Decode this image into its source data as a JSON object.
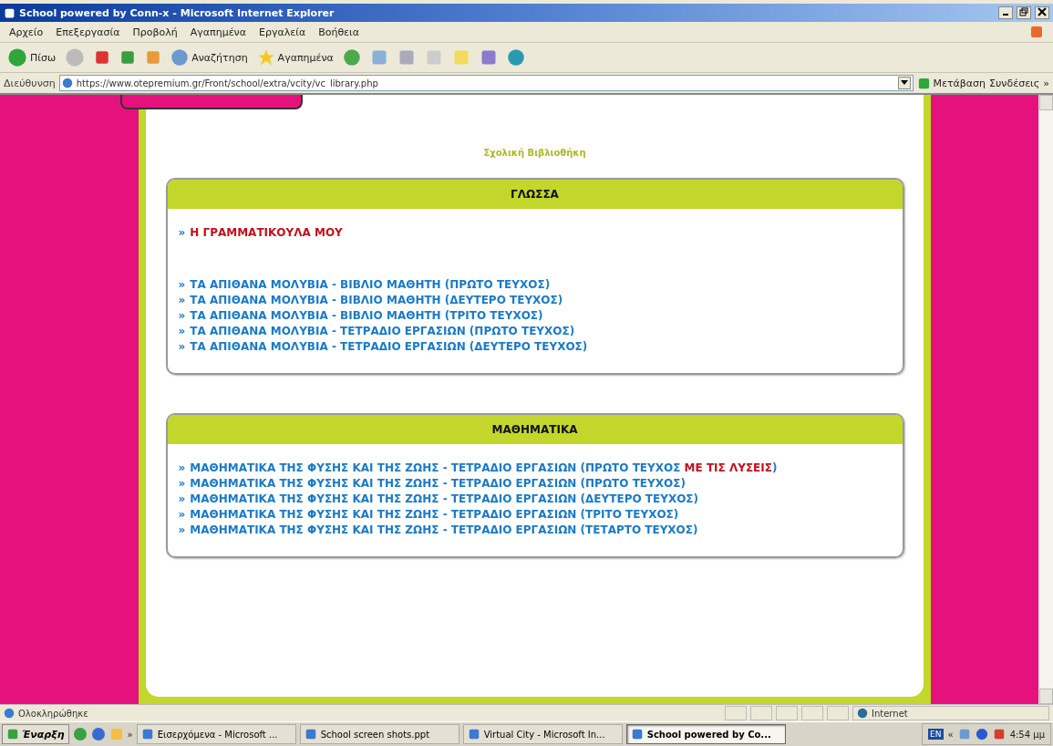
{
  "window": {
    "title": "School powered by Conn-x - Microsoft Internet Explorer"
  },
  "menu": [
    "Αρχείο",
    "Επεξεργασία",
    "Προβολή",
    "Αγαπημένα",
    "Εργαλεία",
    "Βοήθεια"
  ],
  "toolbar": {
    "back": "Πίσω",
    "search": "Αναζήτηση",
    "favorites": "Αγαπημένα"
  },
  "address_bar": {
    "label": "Διεύθυνση",
    "value": "https://www.otepremium.gr/Front/school/extra/vcity/vc_library.php",
    "go": "Μετάβαση",
    "links": "Συνδέσεις",
    "more": "»"
  },
  "page": {
    "title": "Σχολική Βιβλιοθήκη",
    "sections": [
      {
        "heading": "ΓΛΩΣΣΑ",
        "groups": [
          {
            "items": [
              {
                "bullet": "»",
                "color": "#c0101c",
                "parts": [
                  {
                    "text": "Η ΓΡΑΜΜΑΤΙΚΟΥΛΑ ΜΟΥ",
                    "kind": "plain"
                  }
                ]
              }
            ]
          },
          {
            "items": [
              {
                "bullet": "»",
                "color": "#1a7ac8",
                "parts": [
                  {
                    "text": "ΤΑ ΑΠΙΘΑΝΑ ΜΟΛΥΒΙΑ - ΒΙΒΛΙΟ ΜΑΘΗΤΗ (ΠΡΩΤΟ ΤΕΥΧΟΣ)",
                    "kind": "plain"
                  }
                ]
              },
              {
                "bullet": "»",
                "color": "#1a7ac8",
                "parts": [
                  {
                    "text": "ΤΑ ΑΠΙΘΑΝΑ ΜΟΛΥΒΙΑ - ΒΙΒΛΙΟ ΜΑΘΗΤΗ (ΔΕΥΤΕΡΟ ΤΕΥΧΟΣ)",
                    "kind": "plain"
                  }
                ]
              },
              {
                "bullet": "»",
                "color": "#1a7ac8",
                "parts": [
                  {
                    "text": "ΤΑ ΑΠΙΘΑΝΑ ΜΟΛΥΒΙΑ - ΒΙΒΛΙΟ ΜΑΘΗΤΗ (ΤΡΙΤΟ ΤΕΥΧΟΣ)",
                    "kind": "plain"
                  }
                ]
              },
              {
                "bullet": "»",
                "color": "#1a7ac8",
                "parts": [
                  {
                    "text": "ΤΑ ΑΠΙΘΑΝΑ ΜΟΛΥΒΙΑ - ΤΕΤΡΑΔΙΟ ΕΡΓΑΣΙΩΝ (ΠΡΩΤΟ ΤΕΥΧΟΣ)",
                    "kind": "plain"
                  }
                ]
              },
              {
                "bullet": "»",
                "color": "#1a7ac8",
                "parts": [
                  {
                    "text": "ΤΑ ΑΠΙΘΑΝΑ ΜΟΛΥΒΙΑ - ΤΕΤΡΑΔΙΟ ΕΡΓΑΣΙΩΝ (ΔΕΥΤΕΡΟ ΤΕΥΧΟΣ)",
                    "kind": "plain"
                  }
                ]
              }
            ]
          }
        ]
      },
      {
        "heading": "ΜΑΘΗΜΑΤΙΚΑ",
        "groups": [
          {
            "items": [
              {
                "bullet": "»",
                "color": "#1a7ac8",
                "parts": [
                  {
                    "text": "ΜΑΘΗΜΑΤΙΚΑ ΤΗΣ ΦΥΣΗΣ ΚΑΙ ΤΗΣ ΖΩΗΣ - ΤΕΤΡΑΔΙΟ ΕΡΓΑΣΙΩΝ (ΠΡΩΤΟ ΤΕΥΧΟΣ ",
                    "kind": "plain"
                  },
                  {
                    "text": "ΜΕ ΤΙΣ ΛΥΣΕΙΣ",
                    "kind": "highlight"
                  },
                  {
                    "text": ")",
                    "kind": "plain"
                  }
                ]
              },
              {
                "bullet": "»",
                "color": "#1a7ac8",
                "parts": [
                  {
                    "text": "ΜΑΘΗΜΑΤΙΚΑ ΤΗΣ ΦΥΣΗΣ ΚΑΙ ΤΗΣ ΖΩΗΣ - ΤΕΤΡΑΔΙΟ ΕΡΓΑΣΙΩΝ (ΠΡΩΤΟ ΤΕΥΧΟΣ)",
                    "kind": "plain"
                  }
                ]
              },
              {
                "bullet": "»",
                "color": "#1a7ac8",
                "parts": [
                  {
                    "text": "ΜΑΘΗΜΑΤΙΚΑ ΤΗΣ ΦΥΣΗΣ ΚΑΙ ΤΗΣ ΖΩΗΣ - ΤΕΤΡΑΔΙΟ ΕΡΓΑΣΙΩΝ (ΔΕΥΤΕΡΟ ΤΕΥΧΟΣ)",
                    "kind": "plain"
                  }
                ]
              },
              {
                "bullet": "»",
                "color": "#1a7ac8",
                "parts": [
                  {
                    "text": "ΜΑΘΗΜΑΤΙΚΑ ΤΗΣ ΦΥΣΗΣ ΚΑΙ ΤΗΣ ΖΩΗΣ - ΤΕΤΡΑΔΙΟ ΕΡΓΑΣΙΩΝ (ΤΡΙΤΟ ΤΕΥΧΟΣ)",
                    "kind": "plain"
                  }
                ]
              },
              {
                "bullet": "»",
                "color": "#1a7ac8",
                "parts": [
                  {
                    "text": "ΜΑΘΗΜΑΤΙΚΑ ΤΗΣ ΦΥΣΗΣ ΚΑΙ ΤΗΣ ΖΩΗΣ - ΤΕΤΡΑΔΙΟ ΕΡΓΑΣΙΩΝ (ΤΕΤΑΡΤΟ ΤΕΥΧΟΣ)",
                    "kind": "plain"
                  }
                ]
              }
            ]
          }
        ]
      }
    ]
  },
  "status_bar": {
    "text": "Ολοκληρώθηκε",
    "zone": "Internet"
  },
  "taskbar": {
    "start": "Έναρξη",
    "more": "»",
    "tasks": [
      {
        "label": "Εισερχόμενα - Microsoft ...",
        "selected": false
      },
      {
        "label": "School screen shots.ppt",
        "selected": false
      },
      {
        "label": "Virtual City - Microsoft In...",
        "selected": false
      },
      {
        "label": "School powered by Co...",
        "selected": true
      }
    ],
    "tray_more": "«",
    "clock": "4:54 μμ",
    "language": "EN"
  }
}
